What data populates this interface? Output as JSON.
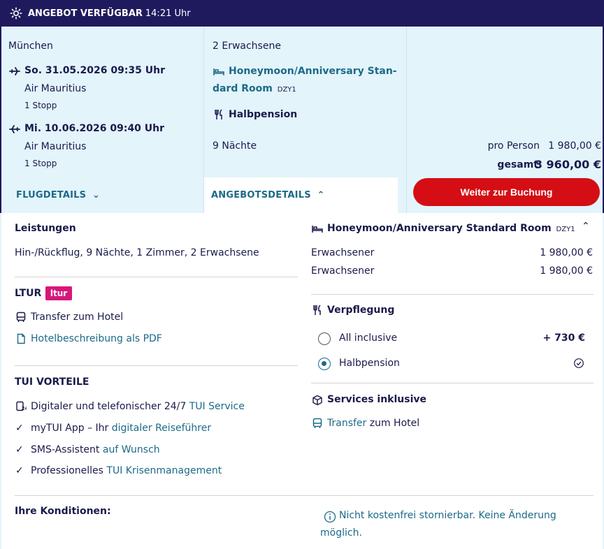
{
  "topbar": {
    "label": "ANGEBOT VERFÜGBAR",
    "time": "14:21 Uhr"
  },
  "flight": {
    "origin": "München",
    "outbound": {
      "date": "So. 31.05.2026 09:35 Uhr",
      "airline": "Air Mauritius",
      "stops": "1 Stopp"
    },
    "inbound": {
      "date": "Mi. 10.06.2026 09:40 Uhr",
      "airline": "Air Mauritius",
      "stops": "1 Stopp"
    },
    "details_link": "FLUGDETAILS"
  },
  "offer": {
    "travellers": "2 Erwachsene",
    "room_line1": "Honeymoon/Anniversary Stan-",
    "room_line2": "dard Room",
    "room_code": "DZY1",
    "board": "Halbpension",
    "nights": "9 Nächte",
    "details_link": "ANGEBOTSDETAILS"
  },
  "price": {
    "per_person_label": "pro Person",
    "per_person_value": "1 980,00 €",
    "total_label": "gesamt",
    "total_value": "3 960,00 €",
    "book_button": "Weiter zur Buchung"
  },
  "leistungen": {
    "heading": "Leistungen",
    "text": "Hin-/Rückflug, 9 Nächte, 1 Zimmer, 2 Erwachsene"
  },
  "ltur": {
    "heading": "LTUR",
    "badge": "ltur",
    "transfer": "Transfer zum Hotel",
    "pdf_link": "Hotelbeschreibung als PDF"
  },
  "tui_vorteile": {
    "heading": "TUI VORTEILE",
    "items": [
      {
        "plain": "Digitaler und telefonischer 24/7 ",
        "link": "TUI Service"
      },
      {
        "plain": "myTUI App – Ihr ",
        "link": "digitaler Reiseführer"
      },
      {
        "plain": "SMS-Assistent ",
        "link": "auf Wunsch"
      },
      {
        "plain": "Professionelles ",
        "link": "TUI Krisenmanagement"
      }
    ]
  },
  "room_panel": {
    "title": "Honeymoon/Anniversary Standard Room",
    "code": "DZY1",
    "rows": [
      {
        "label": "Erwachsener",
        "value": "1 980,00 €"
      },
      {
        "label": "Erwachsener",
        "value": "1 980,00 €"
      }
    ]
  },
  "verpflegung": {
    "heading": "Verpflegung",
    "options": [
      {
        "label": "All inclusive",
        "extra": "+ 730 €",
        "selected": false
      },
      {
        "label": "Halbpension",
        "extra": "",
        "selected": true
      }
    ]
  },
  "services": {
    "heading": "Services inklusive",
    "link": "Transfer",
    "rest": " zum Hotel"
  },
  "konditionen": {
    "heading": "Ihre Konditionen:",
    "note_line1": "Nicht kostenfrei stornierbar. Keine Änderung",
    "note_line2": "möglich."
  },
  "colors": {
    "navy": "#1f1a5e",
    "light_blue": "#e3f4fb",
    "teal_link": "#1c6a88",
    "red_button": "#d40e14",
    "ltur_pink": "#d6177a"
  }
}
